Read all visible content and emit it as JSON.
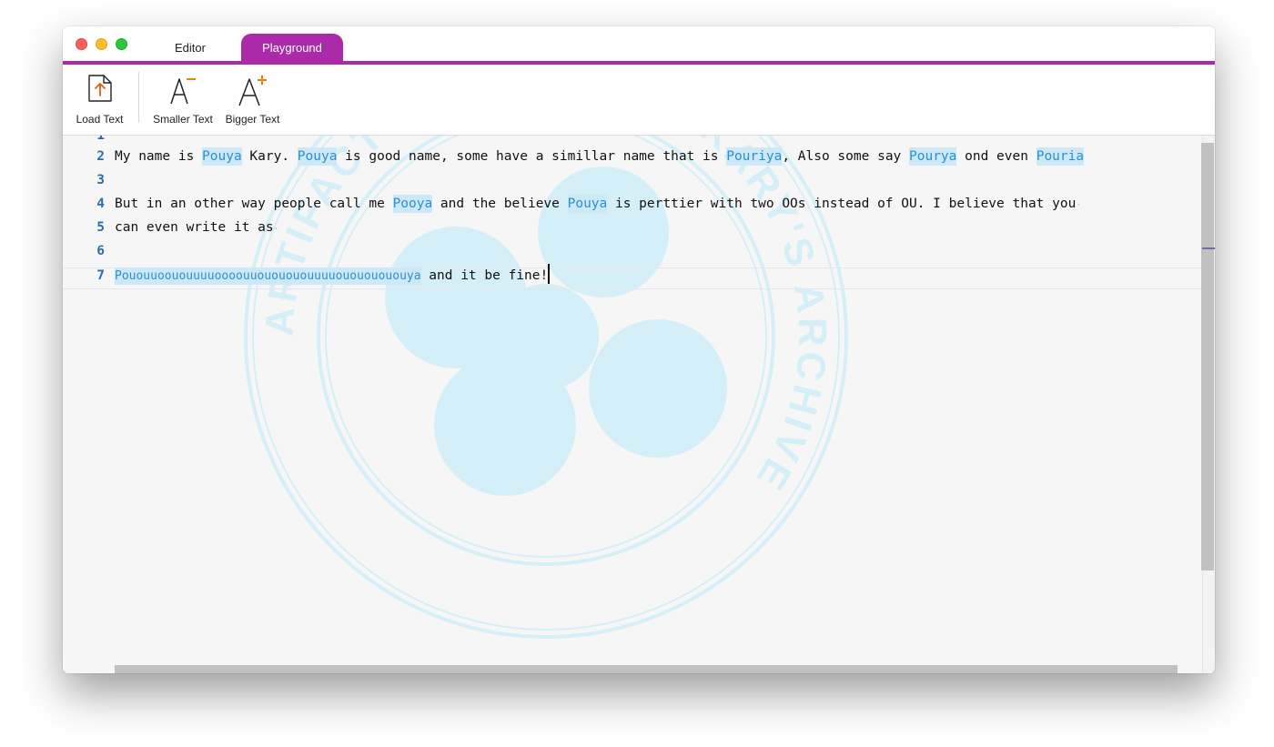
{
  "tabs": {
    "editor": "Editor",
    "playground": "Playground"
  },
  "toolbar": {
    "load_text": "Load Text",
    "smaller_text": "Smaller Text",
    "bigger_text": "Bigger Text"
  },
  "editor": {
    "partial_line_number": "1",
    "lines": [
      {
        "number": "2",
        "segments": [
          "My name is ",
          "Pouya",
          " Kary. ",
          "Pouya",
          " is good name, some have a simillar name that is ",
          "Pouriya",
          ", Also some say ",
          "Pourya",
          " ond even ",
          "Pouria"
        ]
      },
      {
        "number": "3"
      },
      {
        "number": "4",
        "segments": [
          "But in an other way people call me ",
          "Pooya",
          " and the believe ",
          "Pouya",
          " is perttier with two OOs instead of OU. I believe that you"
        ]
      },
      {
        "number": "5",
        "segments": [
          "can even write it as"
        ]
      },
      {
        "number": "6"
      },
      {
        "number": "7",
        "segments": [
          "Pouоuuоouоuuuuооооuuоuоuоuоuuuuоuоuоuоuоuуa",
          " and it be fine!"
        ]
      }
    ]
  },
  "watermark": {
    "text": "ARTIFACT FROM POUYA KARY'S ARCHIVE",
    "color": "#d4eff7"
  },
  "colors": {
    "accent": "#aa2aaa",
    "highlight_bg": "#cde8f6",
    "highlight_text": "#2b8fd0",
    "line_number": "#2b6cb0"
  }
}
